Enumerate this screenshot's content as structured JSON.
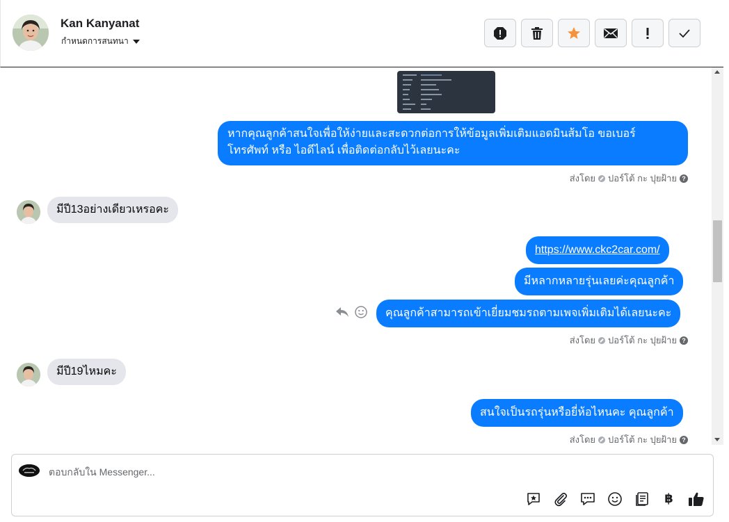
{
  "header": {
    "contact_name": "Kan Kanyanat",
    "assign_label": "กำหนดการสนทนา",
    "actions": [
      {
        "name": "spam-icon",
        "label": "Mark as spam"
      },
      {
        "name": "trash-icon",
        "label": "Delete"
      },
      {
        "name": "star-icon",
        "label": "Star",
        "color": "#f7923b"
      },
      {
        "name": "envelope-icon",
        "label": "Mark as unread"
      },
      {
        "name": "exclamation-icon",
        "label": "Follow up"
      },
      {
        "name": "checkmark-icon",
        "label": "Mark as done"
      }
    ]
  },
  "messages": {
    "out_1": "หากคุณลูกค้าสนใจเพื่อให้ง่ายและสะดวกต่อการให้ข้อมูลเพิ่มเติมแอดมินส้มโอ ขอเบอร์",
    "out_1b": "โทรศัพท์ หรือ ไอดีไลน์ เพื่อติดต่อกลับไว้เลยนะคะ",
    "sent_by_1": "ส่งโดย",
    "agent_1": "ปอร์โต้ กะ ปุยฝ้าย",
    "in_1": "มีปี13อย่างเดียวเหรอคะ",
    "out_link": "https://www.ckc2car.com/",
    "out_2": "มีหลากหลายรุ่นเลยค่ะคุณลูกค้า",
    "out_3": "คุณลูกค้าสามารถเข้าเยี่ยมชมรถตามเพจเพิ่มเติมได้เลยนะคะ",
    "sent_by_2": "ส่งโดย",
    "agent_2": "ปอร์โต้ กะ ปุยฝ้าย",
    "in_2": "มีปี19ไหมคะ",
    "out_4": "สนใจเป็นรถรุ่นหรือยี่ห้อไหนคะ คุณลูกค้า",
    "sent_by_3": "ส่งโดย",
    "agent_3": "ปอร์โต้ กะ ปุยฝ้าย"
  },
  "composer": {
    "placeholder": "ตอบกลับใน Messenger...",
    "tools": [
      "saved-reply-icon",
      "attachment-icon",
      "chat-bubble-icon",
      "emoji-icon",
      "catalog-icon",
      "baht-icon",
      "thumbs-up-icon"
    ],
    "baht_symbol": "฿"
  },
  "colors": {
    "outgoing_bubble": "#0a7cff",
    "incoming_bubble": "#e4e6eb",
    "star": "#f7923b"
  }
}
